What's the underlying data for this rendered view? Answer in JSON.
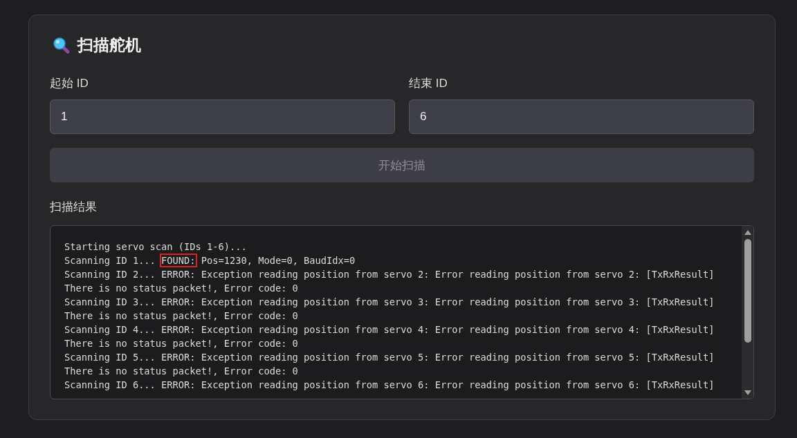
{
  "title": "扫描舵机",
  "fields": [
    {
      "label": "起始 ID",
      "value": "1"
    },
    {
      "label": "结束 ID",
      "value": "6"
    }
  ],
  "scan_button": {
    "label": "开始扫描",
    "disabled": true
  },
  "results": {
    "label": "扫描结果",
    "lines": [
      [
        {
          "text": "Starting servo scan (IDs 1-6)..."
        }
      ],
      [
        {
          "text": "Scanning ID 1... "
        },
        {
          "text": "FOUND:",
          "highlighted": true
        },
        {
          "text": " Pos=1230, Mode=0, BaudIdx=0"
        }
      ],
      [
        {
          "text": "Scanning ID 2... ERROR: Exception reading position from servo 2: Error reading position from servo 2: [TxRxResult]"
        }
      ],
      [
        {
          "text": "There is no status packet!, Error code: 0"
        }
      ],
      [
        {
          "text": "Scanning ID 3... ERROR: Exception reading position from servo 3: Error reading position from servo 3: [TxRxResult]"
        }
      ],
      [
        {
          "text": "There is no status packet!, Error code: 0"
        }
      ],
      [
        {
          "text": "Scanning ID 4... ERROR: Exception reading position from servo 4: Error reading position from servo 4: [TxRxResult]"
        }
      ],
      [
        {
          "text": "There is no status packet!, Error code: 0"
        }
      ],
      [
        {
          "text": "Scanning ID 5... ERROR: Exception reading position from servo 5: Error reading position from servo 5: [TxRxResult]"
        }
      ],
      [
        {
          "text": "There is no status packet!, Error code: 0"
        }
      ],
      [
        {
          "text": "Scanning ID 6... ERROR: Exception reading position from servo 6: Error reading position from servo 6: [TxRxResult]"
        }
      ]
    ]
  }
}
